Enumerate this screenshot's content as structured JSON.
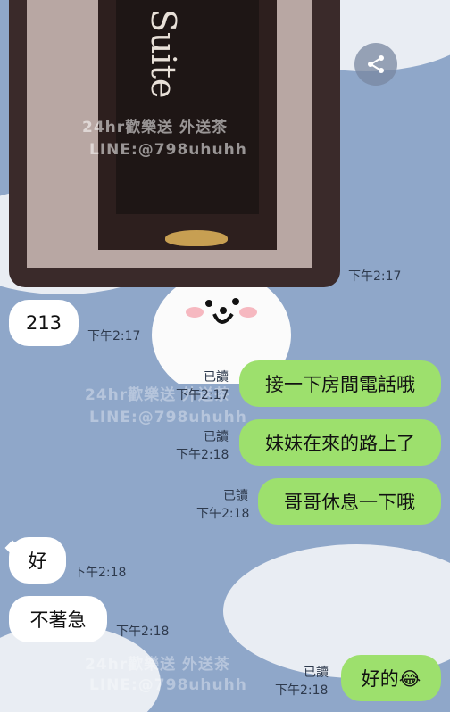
{
  "image_message": {
    "sign_text": "Suite",
    "watermark_line1": "24hr歡樂送 外送茶",
    "watermark_line2": "LINE:@798uhuhh",
    "time": "下午2:17"
  },
  "background_watermarks": [
    {
      "text": "24hr歡樂送 外送茶"
    },
    {
      "text": "LINE:@798uhuhh"
    }
  ],
  "messages": [
    {
      "side": "in",
      "text": "213",
      "time": "下午2:17"
    },
    {
      "side": "out",
      "text": "接一下房間電話哦",
      "read": "已讀",
      "time": "下午2:17"
    },
    {
      "side": "out",
      "text": "妹妹在來的路上了",
      "read": "已讀",
      "time": "下午2:18"
    },
    {
      "side": "out",
      "text": "哥哥休息一下哦",
      "read": "已讀",
      "time": "下午2:18"
    },
    {
      "side": "in",
      "text": "好",
      "time": "下午2:18"
    },
    {
      "side": "in",
      "text": "不著急",
      "time": "下午2:18"
    },
    {
      "side": "out",
      "text": "好的😂",
      "read": "已讀",
      "time": "下午2:18"
    }
  ],
  "icons": {
    "share": "share-icon"
  },
  "colors": {
    "outgoing_bubble": "#9de06d",
    "incoming_bubble": "#ffffff",
    "background": "#8fa7c9"
  }
}
